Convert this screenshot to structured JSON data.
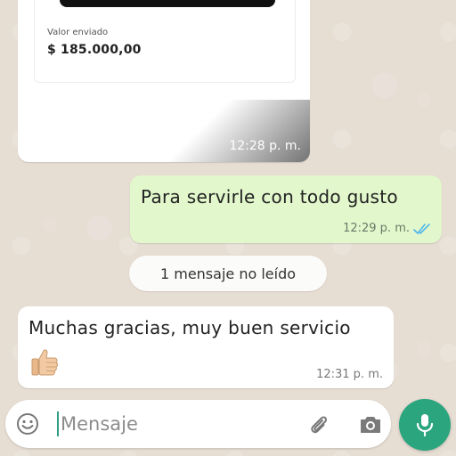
{
  "receipt": {
    "label": "Valor enviado",
    "value": "$ 185.000,00",
    "time": "12:28 p. m."
  },
  "outgoing": {
    "text": "Para servirle con todo gusto",
    "time": "12:29 p. m.",
    "status_icon": "double-check-read-icon"
  },
  "unread_banner": "1 mensaje no leído",
  "incoming": {
    "text": "Muchas gracias, muy buen servicio",
    "emoji": "thumbs-up-icon",
    "time": "12:31 p. m."
  },
  "composer": {
    "placeholder": "Mensaje",
    "emoji_icon": "emoji-icon",
    "attach_icon": "paperclip-icon",
    "camera_icon": "camera-icon",
    "mic_icon": "microphone-icon"
  },
  "colors": {
    "outgoing_bubble": "#e2f7cb",
    "mic_button": "#2aa57e",
    "read_ticks": "#4fb6ec"
  }
}
